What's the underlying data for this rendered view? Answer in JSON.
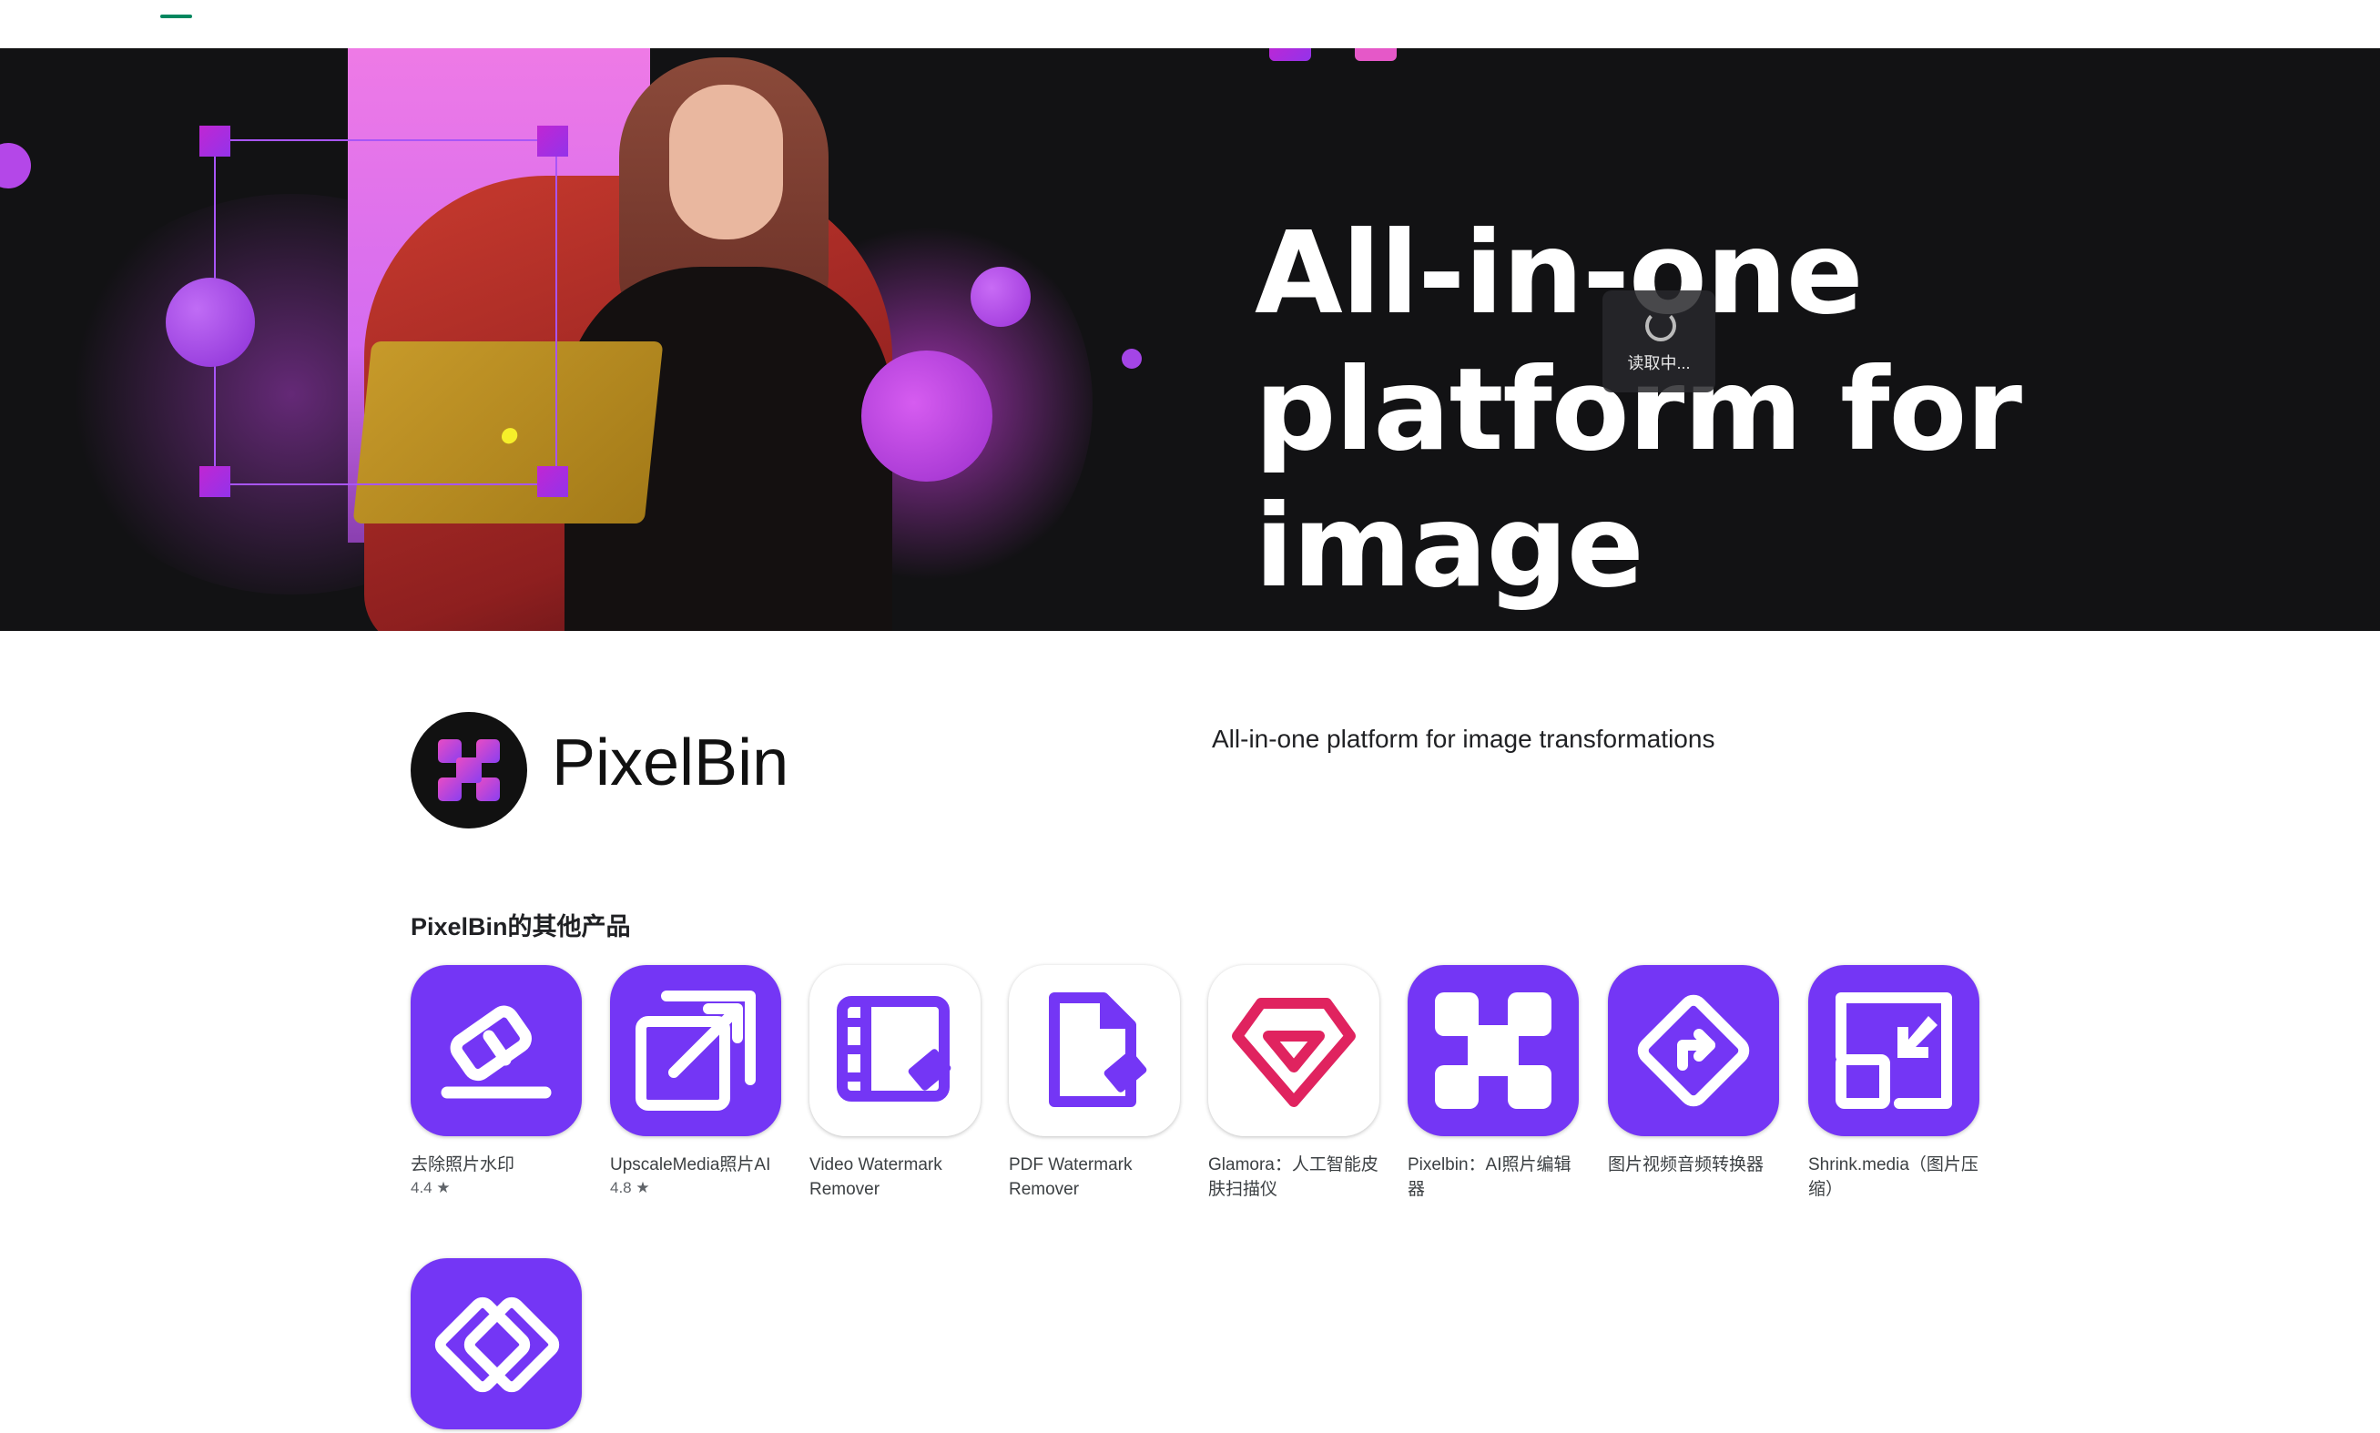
{
  "hero": {
    "title": "All-in-one platform for image transformations",
    "loading_text": "读取中..."
  },
  "developer": {
    "name": "PixelBin",
    "tagline": "All-in-one platform for image transformations"
  },
  "more_apps": {
    "section_title": "PixelBin的其他产品",
    "apps": [
      {
        "name": "去除照片水印",
        "rating": "4.4 ★",
        "icon": "eraser-icon"
      },
      {
        "name": "UpscaleMedia照片AI",
        "rating": "4.8 ★",
        "icon": "upscale-icon"
      },
      {
        "name": "Video Watermark Remover",
        "rating": "",
        "icon": "video-watermark-icon"
      },
      {
        "name": "PDF Watermark Remover",
        "rating": "",
        "icon": "pdf-watermark-icon"
      },
      {
        "name": "Glamora：人工智能皮肤扫描仪",
        "rating": "",
        "icon": "glamora-gem-icon"
      },
      {
        "name": "Pixelbin：AI照片编辑器",
        "rating": "",
        "icon": "pixelbin-icon"
      },
      {
        "name": "图片视频音频转换器",
        "rating": "",
        "icon": "converter-icon"
      },
      {
        "name": "Shrink.media（图片压缩）",
        "rating": "",
        "icon": "shrink-icon"
      },
      {
        "name": "",
        "rating": "",
        "icon": "link-icon"
      }
    ]
  },
  "colors": {
    "brand_purple": "#7436f5",
    "hero_bg": "#121214",
    "glamora_pink": "#e0235f",
    "tab_indicator": "#01875f"
  }
}
